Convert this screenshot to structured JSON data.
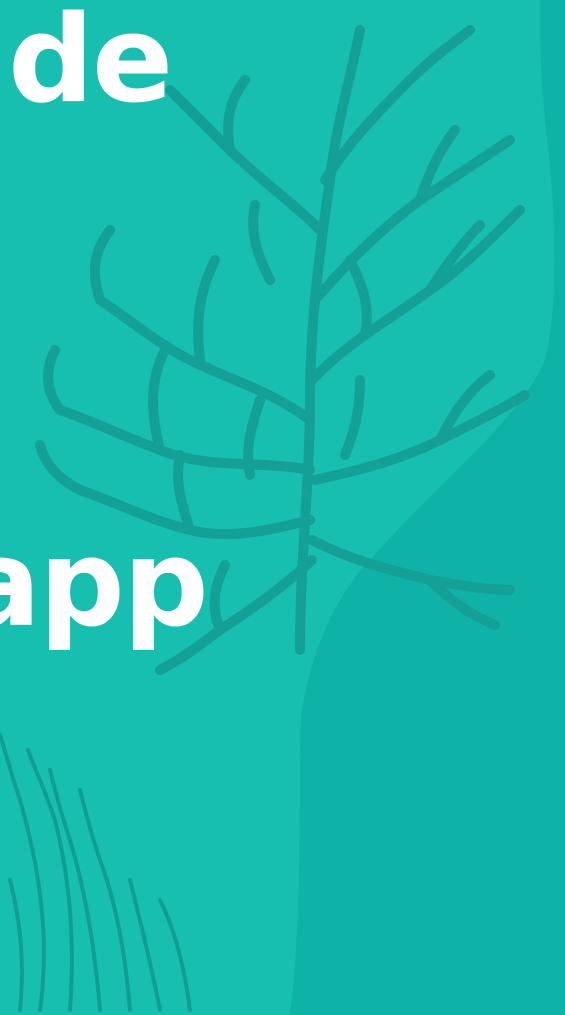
{
  "headline": {
    "line1": "de",
    "line2": "app"
  },
  "colors": {
    "background": "#17bfb0",
    "background_dark": "#0eb2a6",
    "coral": "#149f97",
    "seaweed": "#119d95",
    "text": "#ffffff"
  },
  "decorations": [
    "coral-illustration",
    "seaweed-illustration"
  ]
}
